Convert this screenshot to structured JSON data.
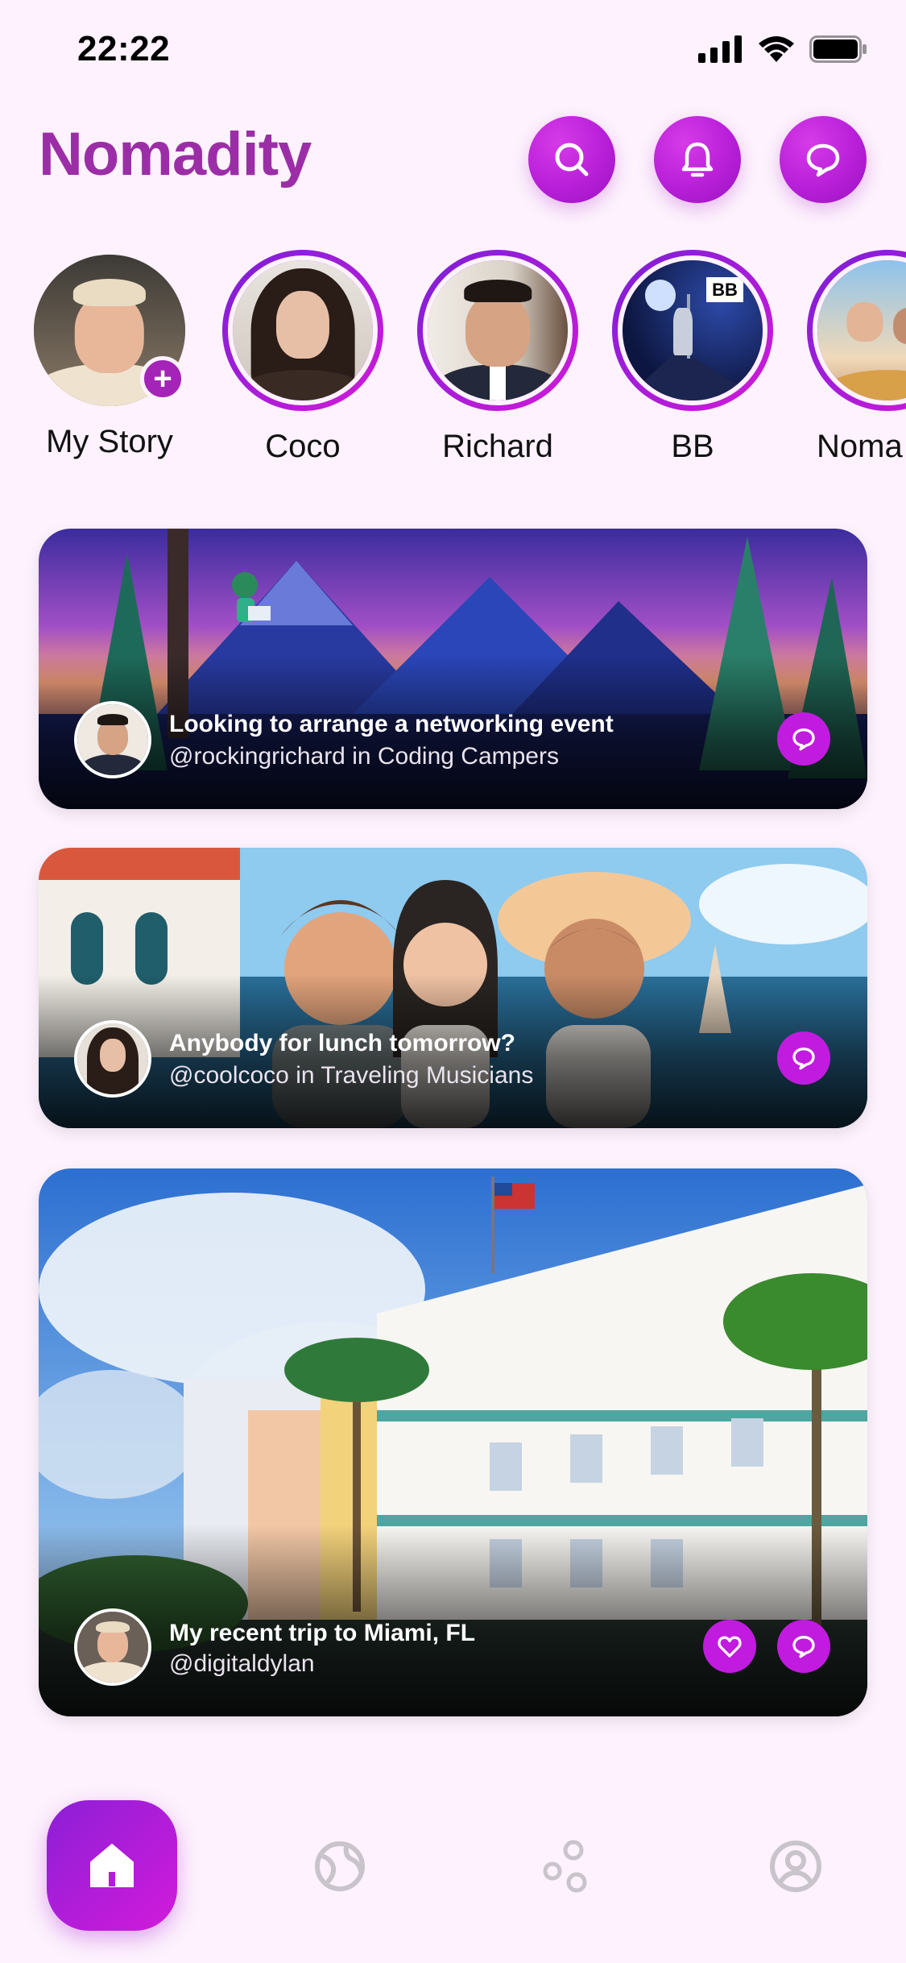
{
  "status_bar": {
    "time": "22:22"
  },
  "header": {
    "brand": "Nomadity",
    "brand_color": "#9b2ea6",
    "buttons": [
      {
        "icon": "search-icon"
      },
      {
        "icon": "bell-icon"
      },
      {
        "icon": "chat-bubble-icon"
      }
    ]
  },
  "stories": [
    {
      "label": "My Story",
      "has_add_badge": true,
      "badge_symbol": "+"
    },
    {
      "label": "Coco"
    },
    {
      "label": "Richard"
    },
    {
      "label": "BB",
      "flag_text": "BB"
    },
    {
      "label": "Noma"
    }
  ],
  "feed": [
    {
      "title": "Looking to arrange a networking event",
      "subtitle": "@rockingrichard in Coding Campers",
      "actions": [
        "chat-bubble-icon"
      ]
    },
    {
      "title": "Anybody for lunch tomorrow?",
      "subtitle": "@coolcoco in Traveling Musicians",
      "actions": [
        "chat-bubble-icon"
      ]
    },
    {
      "title": "My recent trip to Miami, FL",
      "subtitle": "@digitaldylan",
      "actions": [
        "heart-icon",
        "chat-bubble-icon"
      ]
    }
  ],
  "bottom_nav": {
    "items": [
      {
        "icon": "home-icon",
        "active": true
      },
      {
        "icon": "globe-icon",
        "active": false
      },
      {
        "icon": "community-icon",
        "active": false
      },
      {
        "icon": "profile-icon",
        "active": false
      }
    ]
  },
  "colors": {
    "accent": "#c21be0",
    "background": "#fdf2fd",
    "nav_inactive": "#c9c3cc"
  }
}
